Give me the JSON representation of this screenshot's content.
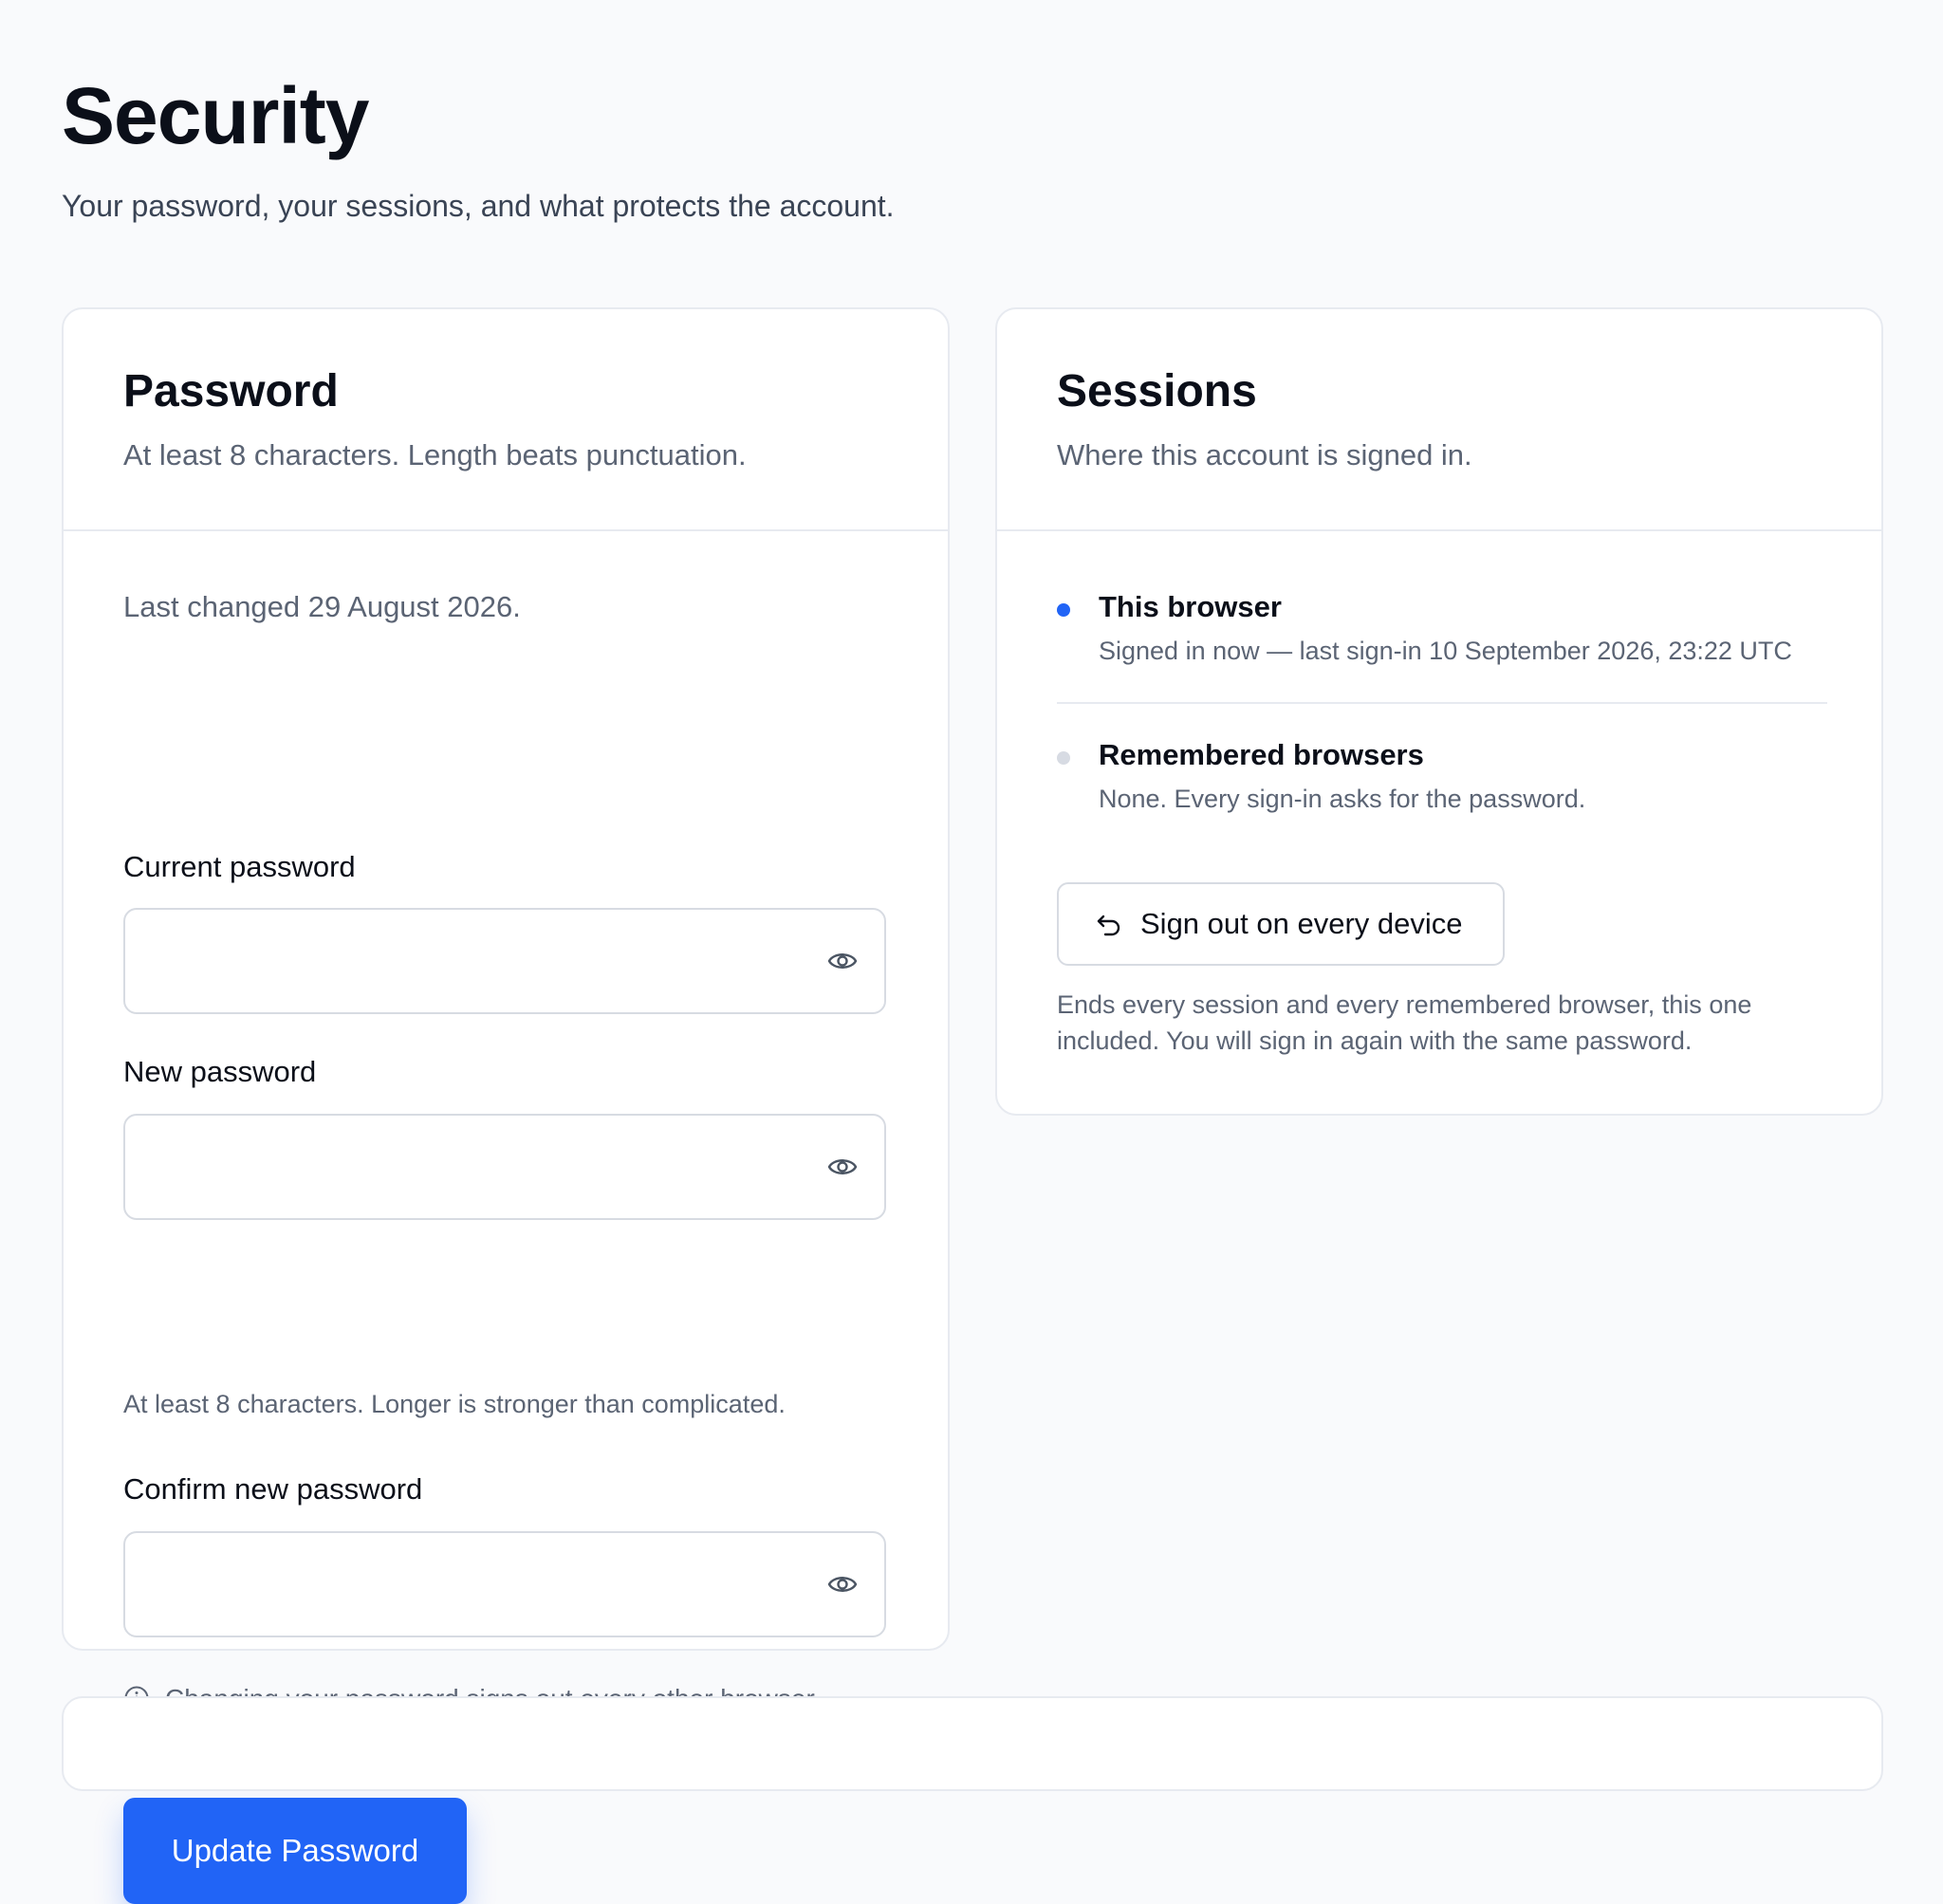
{
  "header": {
    "title": "Security",
    "subtitle": "Your password, your sessions, and what protects the account."
  },
  "password_card": {
    "title": "Password",
    "description": "At least 8 characters. Length beats punctuation.",
    "last_changed": "Last changed 29 August 2026.",
    "fields": [
      {
        "label": "Current password",
        "value": "",
        "placeholder": ""
      },
      {
        "label": "New password",
        "value": "",
        "placeholder": "",
        "hint": "At least 8 characters. Longer is stronger than complicated."
      },
      {
        "label": "Confirm new password",
        "value": "",
        "placeholder": ""
      }
    ],
    "notice": "Changing your password signs out every other browser, including any that were remembered.",
    "submit_label": "Update Password"
  },
  "sessions_card": {
    "title": "Sessions",
    "description": "Where this account is signed in.",
    "sessions": [
      {
        "title": "This browser",
        "meta": "Signed in now — last sign-in 10 September 2026, 23:22 UTC",
        "status_color": "#2164f6"
      },
      {
        "title": "Remembered browsers",
        "meta": "None. Every sign-in asks for the password.",
        "status_color": "#d7dbe3"
      }
    ],
    "signout_label": "Sign out on every device",
    "signout_description": "Ends every session and every remembered browser, this one included. You will sign in again with the same password."
  },
  "icons": {
    "reveal": "eye-icon",
    "info": "info-icon",
    "signout": "undo-arrow-icon"
  },
  "colors": {
    "accent": "#2164f6",
    "background": "#f9fafc",
    "border": "#e7eaf0",
    "muted_text": "#5b6474"
  }
}
